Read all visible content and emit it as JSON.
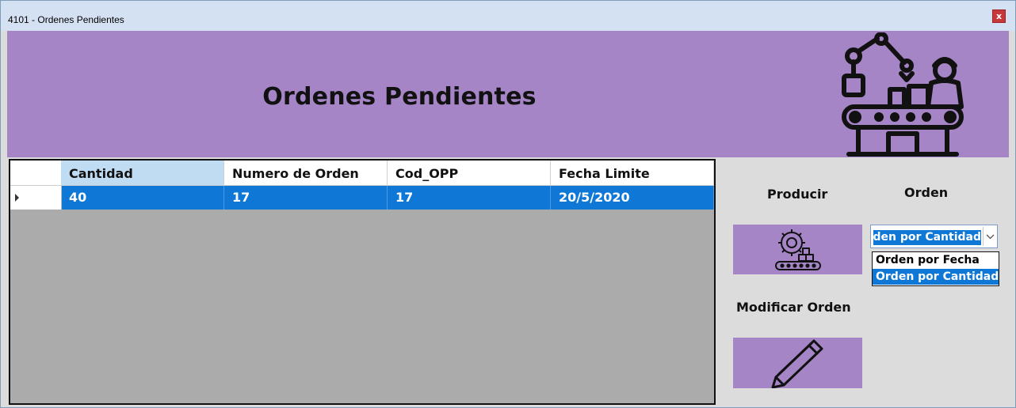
{
  "window": {
    "title": "4101 - Ordenes Pendientes",
    "close_label": "x"
  },
  "banner": {
    "title": "Ordenes Pendientes",
    "icon": "factory-conveyor-icon"
  },
  "grid": {
    "columns": [
      "Cantidad",
      "Numero de Orden",
      "Cod_OPP",
      "Fecha Limite"
    ],
    "rows": [
      [
        "40",
        "17",
        "17",
        "20/5/2020"
      ]
    ]
  },
  "actions": {
    "producir_label": "Producir",
    "producir_icon": "gear-conveyor-icon",
    "modificar_label": "Modificar Orden",
    "modificar_icon": "pencil-icon"
  },
  "orden": {
    "label": "Orden",
    "selected": "Orden por Cantidad",
    "options": [
      "Orden por Fecha",
      "Orden por Cantidad"
    ]
  },
  "colors": {
    "accent": "#a585c6",
    "selection": "#0f78d7",
    "grid_background": "#ababab"
  }
}
